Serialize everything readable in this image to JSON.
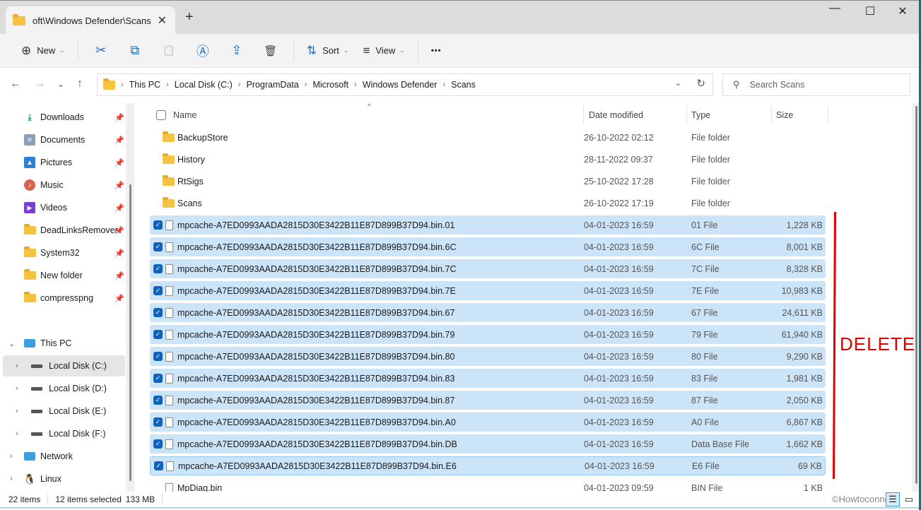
{
  "window": {
    "tab_title": "oft\\Windows Defender\\Scans",
    "tab_close_icon": "✕",
    "new_tab_icon": "+",
    "minimize_icon": "—",
    "maximize_icon": "☐",
    "close_icon": "✕"
  },
  "toolbar": {
    "new_label": "New",
    "sort_label": "Sort",
    "view_label": "View",
    "more_label": "•••",
    "icons": {
      "new": "⊕",
      "cut": "✂",
      "copy": "⧉",
      "paste": "📋",
      "rename": "Ⓐ",
      "share": "⇪",
      "delete": "🗑",
      "sort": "⇅",
      "view": "≡"
    }
  },
  "nav": {
    "back": "←",
    "forward": "→",
    "recent": "⌄",
    "up": "↑",
    "breadcrumb": [
      "This PC",
      "Local Disk (C:)",
      "ProgramData",
      "Microsoft",
      "Windows Defender",
      "Scans"
    ],
    "dropdown": "⌄",
    "refresh": "↻",
    "search_placeholder": "Search Scans",
    "search_value": ""
  },
  "sidebar": {
    "quick_access": [
      {
        "label": "Downloads",
        "icon": "download-icon"
      },
      {
        "label": "Documents",
        "icon": "documents-icon"
      },
      {
        "label": "Pictures",
        "icon": "pictures-icon"
      },
      {
        "label": "Music",
        "icon": "music-icon"
      },
      {
        "label": "Videos",
        "icon": "videos-icon"
      },
      {
        "label": "DeadLinksRemover",
        "icon": "folder-icon"
      },
      {
        "label": "System32",
        "icon": "folder-icon"
      },
      {
        "label": "New folder",
        "icon": "folder-icon"
      },
      {
        "label": "compresspng",
        "icon": "folder-icon"
      }
    ],
    "tree": [
      {
        "label": "This PC",
        "icon": "pc-icon"
      },
      {
        "label": "Local Disk (C:)",
        "icon": "drive-icon"
      },
      {
        "label": "Local Disk (D:)",
        "icon": "drive-icon"
      },
      {
        "label": "Local Disk (E:)",
        "icon": "drive-icon"
      },
      {
        "label": "Local Disk (F:)",
        "icon": "drive-icon"
      },
      {
        "label": "Network",
        "icon": "network-icon"
      },
      {
        "label": "Linux",
        "icon": "linux-icon"
      }
    ]
  },
  "columns": {
    "name": "Name",
    "date": "Date modified",
    "type": "Type",
    "size": "Size",
    "sort_indicator": "^"
  },
  "files": [
    {
      "name": "BackupStore",
      "date": "26-10-2022 02:12",
      "type": "File folder",
      "size": "",
      "kind": "folder",
      "selected": false
    },
    {
      "name": "History",
      "date": "28-11-2022 09:37",
      "type": "File folder",
      "size": "",
      "kind": "folder",
      "selected": false
    },
    {
      "name": "RtSigs",
      "date": "25-10-2022 17:28",
      "type": "File folder",
      "size": "",
      "kind": "folder",
      "selected": false
    },
    {
      "name": "Scans",
      "date": "26-10-2022 17:19",
      "type": "File folder",
      "size": "",
      "kind": "folder",
      "selected": false
    },
    {
      "name": "mpcache-A7ED0993AADA2815D30E3422B11E87D899B37D94.bin.01",
      "date": "04-01-2023 16:59",
      "type": "01 File",
      "size": "1,228 KB",
      "kind": "file",
      "selected": true
    },
    {
      "name": "mpcache-A7ED0993AADA2815D30E3422B11E87D899B37D94.bin.6C",
      "date": "04-01-2023 16:59",
      "type": "6C File",
      "size": "8,001 KB",
      "kind": "file",
      "selected": true
    },
    {
      "name": "mpcache-A7ED0993AADA2815D30E3422B11E87D899B37D94.bin.7C",
      "date": "04-01-2023 16:59",
      "type": "7C File",
      "size": "8,328 KB",
      "kind": "file",
      "selected": true
    },
    {
      "name": "mpcache-A7ED0993AADA2815D30E3422B11E87D899B37D94.bin.7E",
      "date": "04-01-2023 16:59",
      "type": "7E File",
      "size": "10,983 KB",
      "kind": "file",
      "selected": true
    },
    {
      "name": "mpcache-A7ED0993AADA2815D30E3422B11E87D899B37D94.bin.67",
      "date": "04-01-2023 16:59",
      "type": "67 File",
      "size": "24,611 KB",
      "kind": "file",
      "selected": true
    },
    {
      "name": "mpcache-A7ED0993AADA2815D30E3422B11E87D899B37D94.bin.79",
      "date": "04-01-2023 16:59",
      "type": "79 File",
      "size": "61,940 KB",
      "kind": "file",
      "selected": true
    },
    {
      "name": "mpcache-A7ED0993AADA2815D30E3422B11E87D899B37D94.bin.80",
      "date": "04-01-2023 16:59",
      "type": "80 File",
      "size": "9,290 KB",
      "kind": "file",
      "selected": true
    },
    {
      "name": "mpcache-A7ED0993AADA2815D30E3422B11E87D899B37D94.bin.83",
      "date": "04-01-2023 16:59",
      "type": "83 File",
      "size": "1,981 KB",
      "kind": "file",
      "selected": true
    },
    {
      "name": "mpcache-A7ED0993AADA2815D30E3422B11E87D899B37D94.bin.87",
      "date": "04-01-2023 16:59",
      "type": "87 File",
      "size": "2,050 KB",
      "kind": "file",
      "selected": true
    },
    {
      "name": "mpcache-A7ED0993AADA2815D30E3422B11E87D899B37D94.bin.A0",
      "date": "04-01-2023 16:59",
      "type": "A0 File",
      "size": "6,867 KB",
      "kind": "file",
      "selected": true
    },
    {
      "name": "mpcache-A7ED0993AADA2815D30E3422B11E87D899B37D94.bin.DB",
      "date": "04-01-2023 16:59",
      "type": "Data Base File",
      "size": "1,662 KB",
      "kind": "file",
      "selected": true
    },
    {
      "name": "mpcache-A7ED0993AADA2815D30E3422B11E87D899B37D94.bin.E6",
      "date": "04-01-2023 16:59",
      "type": "E6 File",
      "size": "69 KB",
      "kind": "file",
      "selected": true,
      "focused": true
    },
    {
      "name": "MpDiag.bin",
      "date": "04-01-2023 09:59",
      "type": "BIN File",
      "size": "1 KB",
      "kind": "file",
      "selected": false
    }
  ],
  "status": {
    "items": "22 items",
    "selected": "12 items selected",
    "size": "133 MB"
  },
  "annotation": {
    "text": "DELETE",
    "color": "#e00000"
  },
  "watermark": "©Howtoconnect",
  "colors": {
    "selection": "#cce4f7",
    "checkbox": "#0f62be",
    "folder": "#f5c342"
  }
}
